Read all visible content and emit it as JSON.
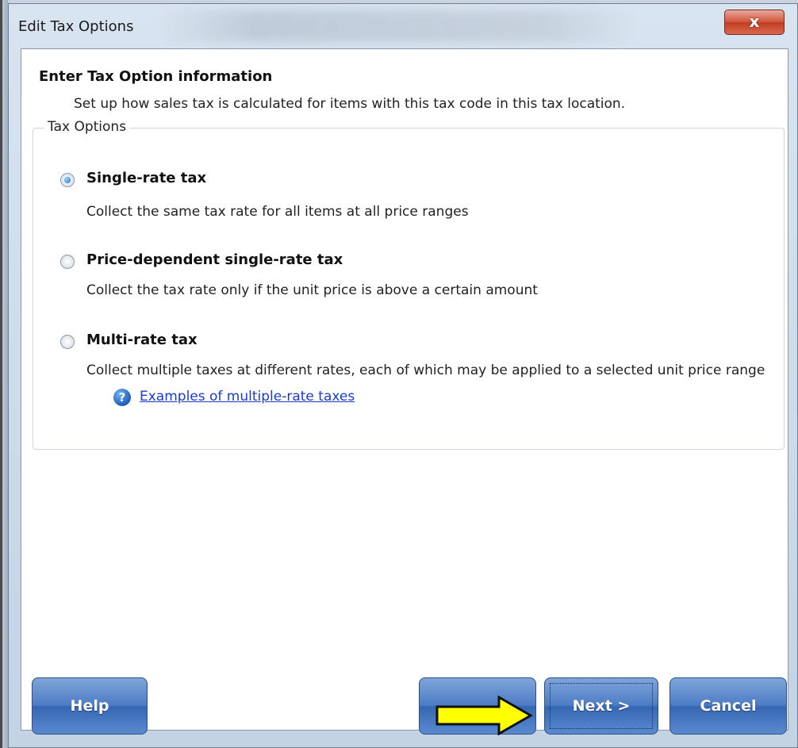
{
  "window": {
    "title": "Edit Tax Options",
    "close_label": "x"
  },
  "content": {
    "heading": "Enter Tax Option information",
    "subheading": "Set up how sales tax is calculated for items with this tax code in this tax location.",
    "group_label": "Tax Options",
    "options": [
      {
        "title": "Single-rate tax",
        "description": "Collect the same tax rate for all items at all price ranges",
        "selected": true
      },
      {
        "title": "Price-dependent single-rate tax",
        "description": "Collect the tax rate only if the unit price is above a certain amount",
        "selected": false
      },
      {
        "title": "Multi-rate tax",
        "description": "Collect multiple taxes at different rates, each of which may be applied to a selected unit price range",
        "selected": false
      }
    ],
    "help_link": "Examples of multiple-rate taxes"
  },
  "buttons": {
    "help": "Help",
    "next": "Next >",
    "cancel": "Cancel"
  },
  "colors": {
    "button_blue": "#4d7dc5",
    "arrow_yellow": "#ffff00",
    "link_blue": "#1a3bcc"
  }
}
